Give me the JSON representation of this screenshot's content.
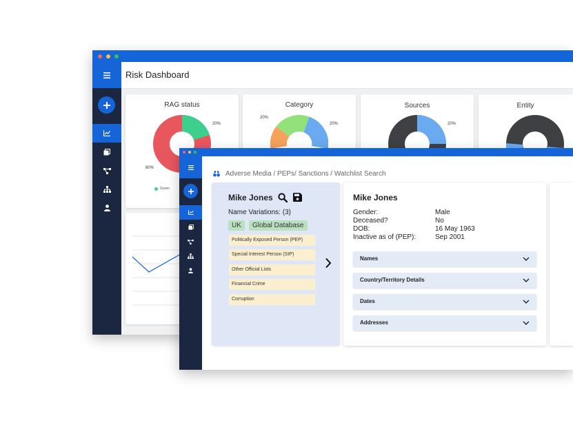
{
  "back_window": {
    "title": "Risk Dashboard",
    "charts": [
      {
        "title": "RAG status",
        "label_top": "20%",
        "label_left": "80%",
        "legend": "Green"
      },
      {
        "title": "Category",
        "label_left": "20%",
        "label_right": "20%"
      },
      {
        "title": "Sources",
        "label_right": "20%"
      },
      {
        "title": "Entity"
      }
    ]
  },
  "front_window": {
    "breadcrumb": "Adverse Media / PEPs/ Sanctions / Watchlist Search",
    "left_panel": {
      "name": "Mike Jones",
      "variations": "Name Variations: (3)",
      "tags": [
        "UK",
        "Global Database"
      ],
      "categories": [
        "Politically Exposed Person (PEP)",
        "Special Interest Person (SIP)",
        "Other Official Lists",
        "Financial Crime",
        "Corruption"
      ]
    },
    "right_panel": {
      "name": "Mike Jones",
      "fields": [
        {
          "label": "Gender:",
          "value": "Male"
        },
        {
          "label": "Deceased?",
          "value": "No"
        },
        {
          "label": "DOB:",
          "value": "16 May 1963"
        },
        {
          "label": "Inactive as of (PEP):",
          "value": "Sep 2001"
        }
      ],
      "sections": [
        "Names",
        "Country/Territory Details",
        "Dates",
        "Addresses"
      ]
    }
  },
  "icons": {
    "menu": "hamburger-icon",
    "add": "plus-icon",
    "nav": [
      "chart-line-icon",
      "layers-icon",
      "network-icon",
      "hierarchy-icon",
      "user-icon"
    ],
    "search": "search-icon",
    "save": "save-icon",
    "next": "chevron-right-icon",
    "expand": "chevron-down-icon",
    "brand": "binoculars-icon"
  },
  "colors": {
    "accent": "#1565d8",
    "sidebar": "#1b2640",
    "rag_red": "#e8575e",
    "rag_green": "#3ecf8e",
    "donut_dark": "#3f4044",
    "donut_blue": "#6aaaf0",
    "donut_orange": "#f6a15c",
    "donut_lightgreen": "#92e27a",
    "tag_green": "#b9e0bf",
    "pill_yellow": "#fbefcf",
    "panel_blue": "#dfe7f6"
  }
}
